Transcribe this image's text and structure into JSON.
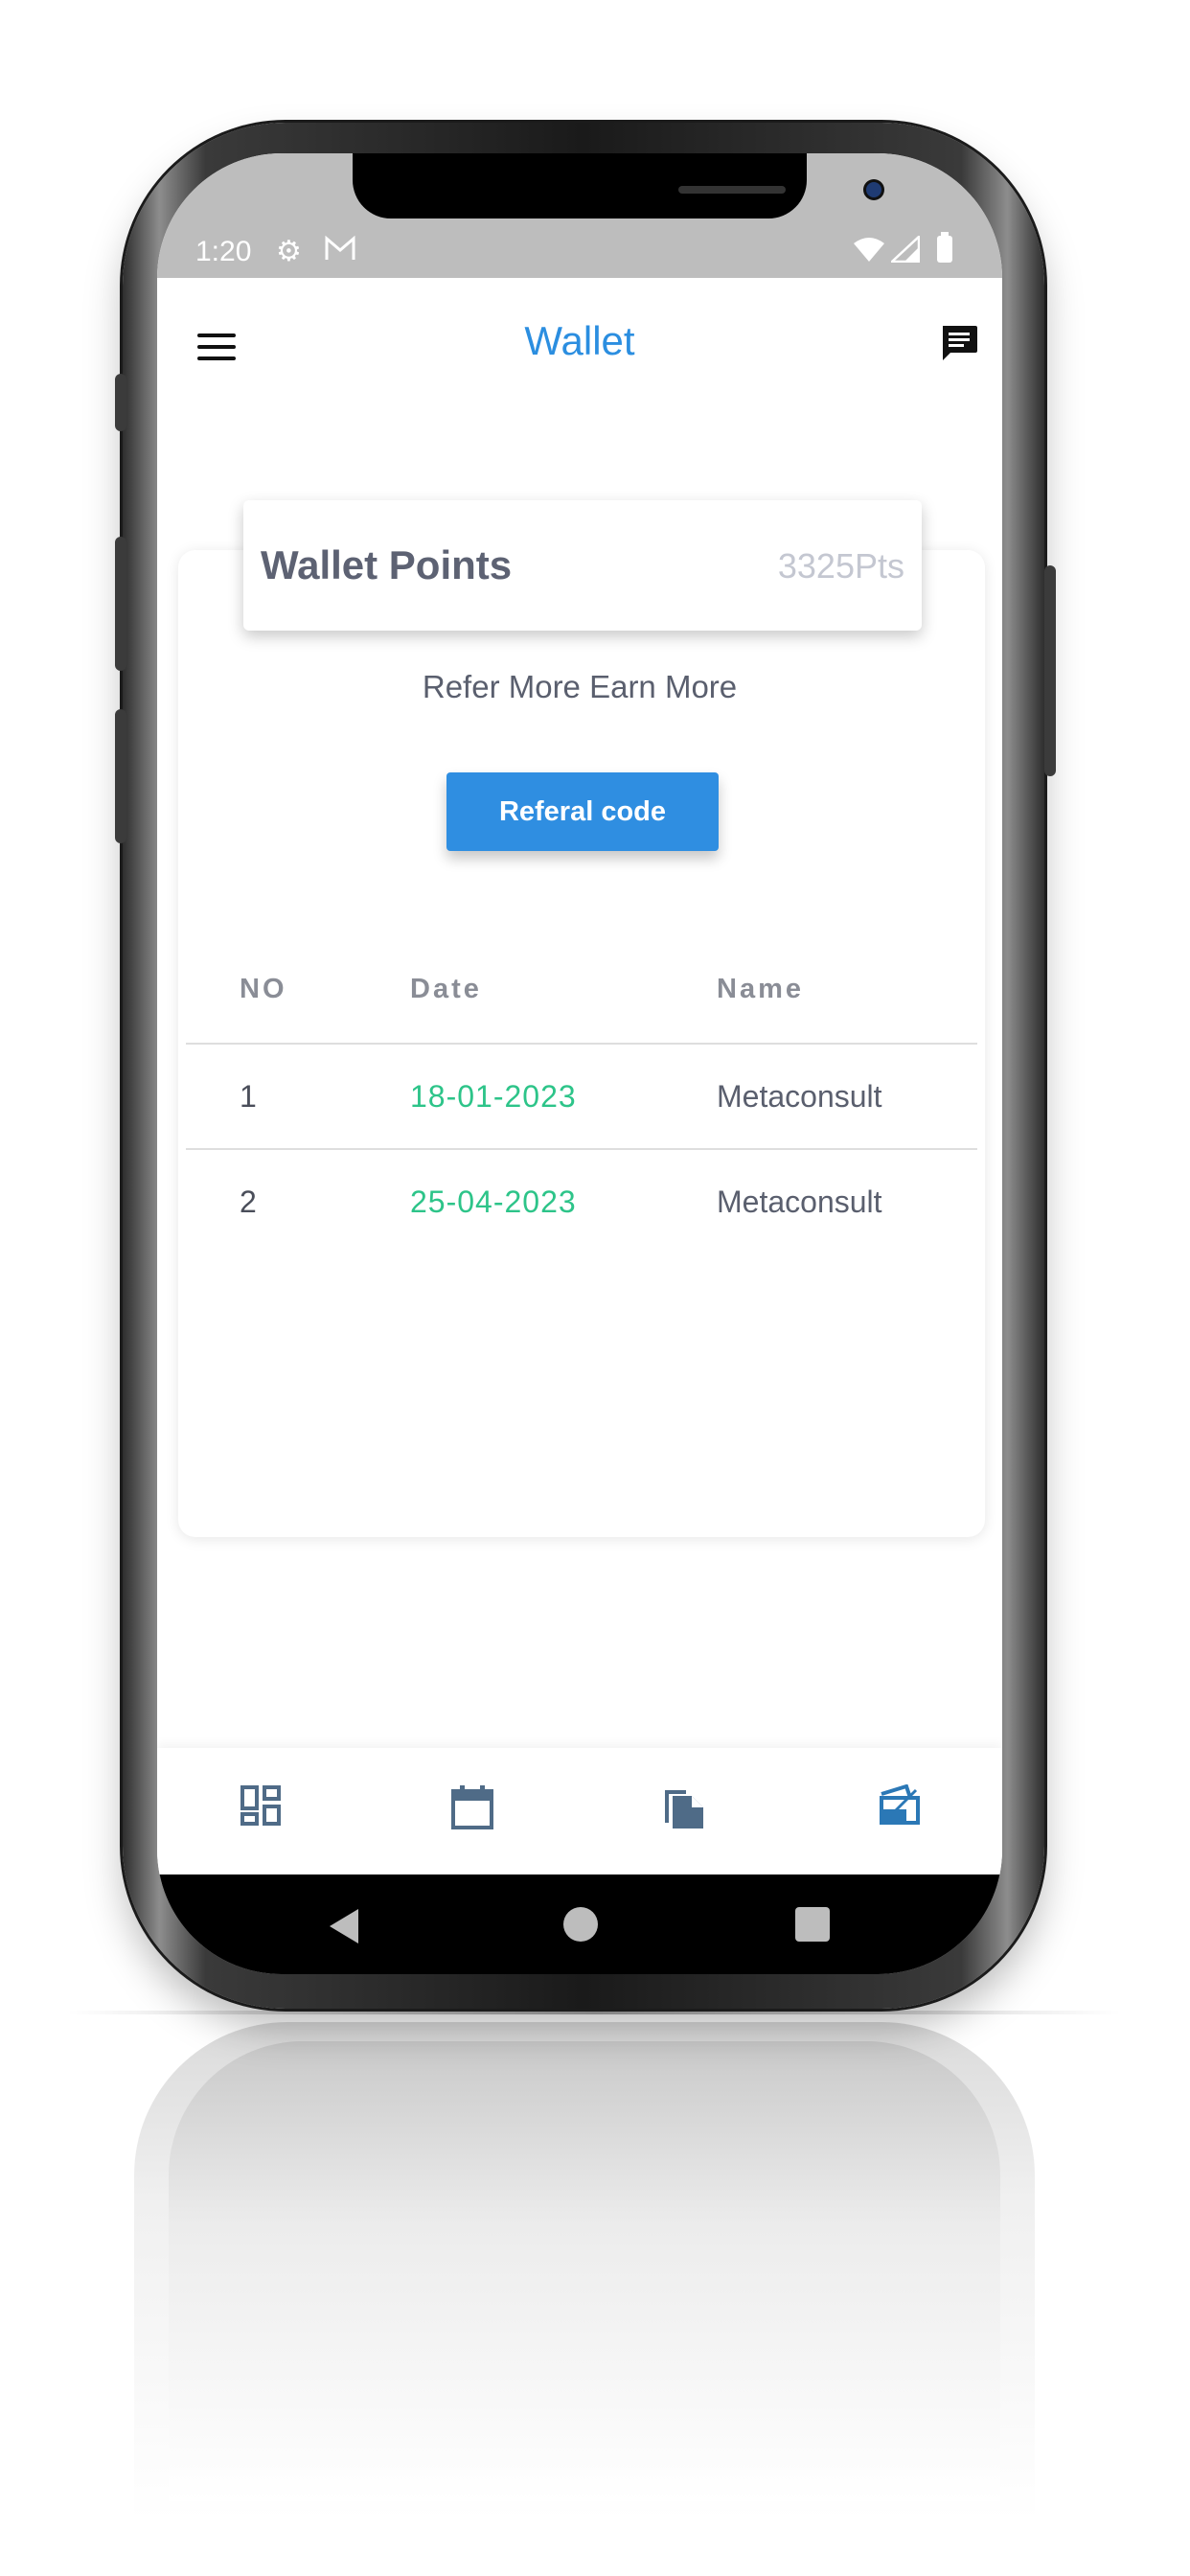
{
  "status_bar": {
    "time": "1:20"
  },
  "app_bar": {
    "title": "Wallet"
  },
  "wallet": {
    "points_label": "Wallet Points",
    "points_value": "3325Pts",
    "tagline": "Refer More Earn More",
    "button_label": "Referal code"
  },
  "table": {
    "headers": [
      "NO",
      "Date",
      "Name"
    ],
    "rows": [
      [
        "1",
        "18-01-2023",
        "Metaconsult"
      ],
      [
        "2",
        "25-04-2023",
        "Metaconsult"
      ]
    ]
  },
  "bottom_nav": {
    "items": [
      {
        "icon": "dashboard-icon",
        "active": false
      },
      {
        "icon": "calendar-icon",
        "active": false
      },
      {
        "icon": "documents-icon",
        "active": false
      },
      {
        "icon": "wallet-icon",
        "active": true
      }
    ]
  },
  "colors": {
    "accent": "#2f8ee1",
    "date_green": "#2dc489",
    "nav_inactive": "#4f6b87",
    "nav_active": "#2b78b6"
  }
}
